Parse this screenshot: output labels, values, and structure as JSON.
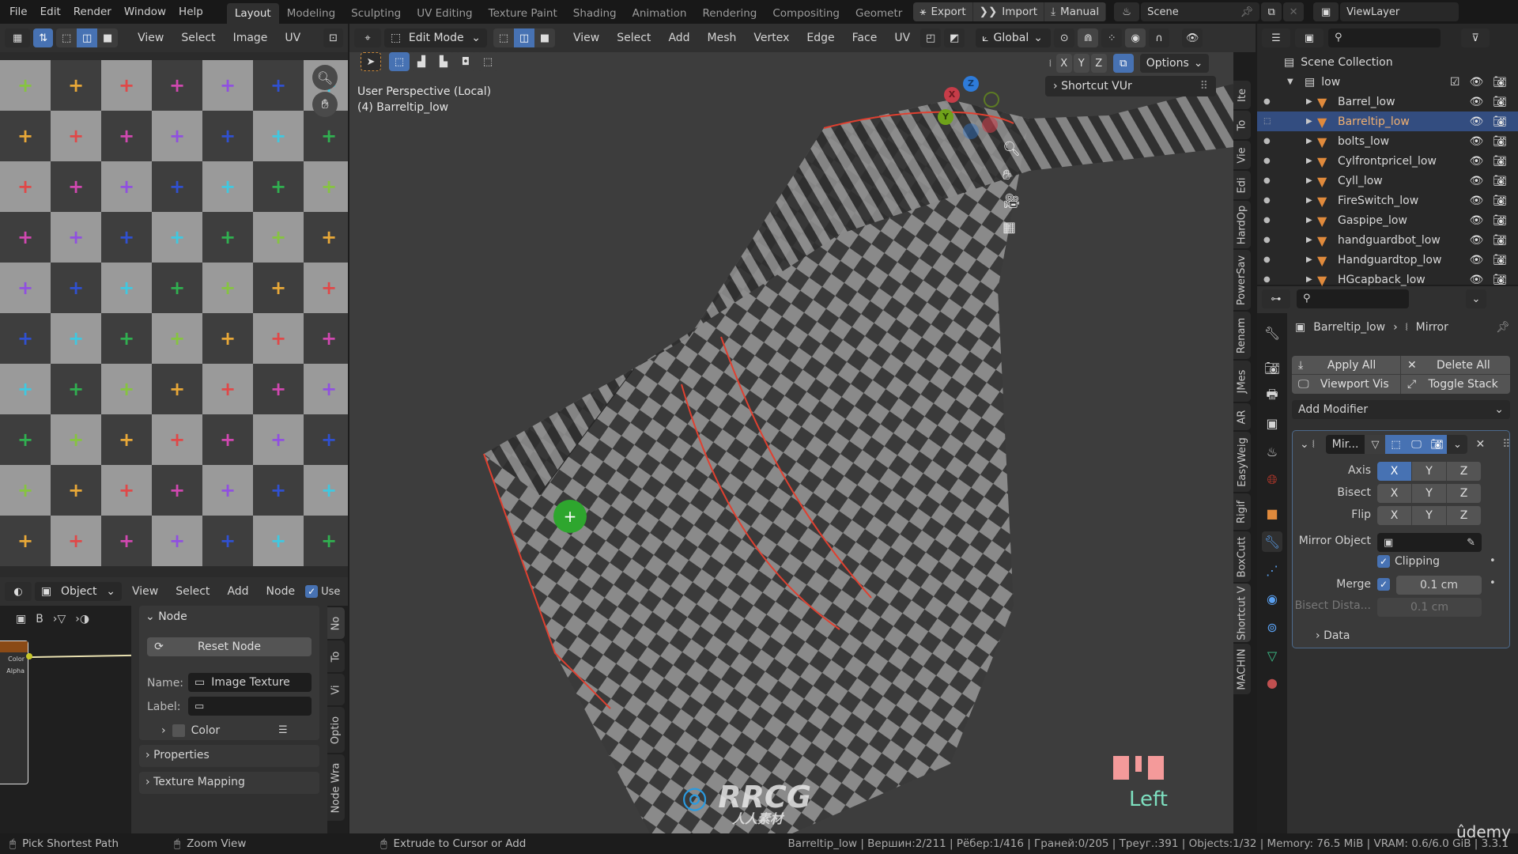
{
  "topbar": {
    "menus": [
      "File",
      "Edit",
      "Render",
      "Window",
      "Help"
    ],
    "workspaces": [
      "Layout",
      "Modeling",
      "Sculpting",
      "UV Editing",
      "Texture Paint",
      "Shading",
      "Animation",
      "Rendering",
      "Compositing",
      "Geometr"
    ],
    "active_workspace": "Layout",
    "export_label": "Export",
    "import_label": "Import",
    "manual_label": "Manual",
    "scene_name": "Scene",
    "view_layer": "ViewLayer"
  },
  "uv_editor": {
    "menus": [
      "View",
      "Select",
      "Image",
      "UV"
    ],
    "colors": [
      "#86c440",
      "#e8a838",
      "#e04848",
      "#d048b0",
      "#9050e0",
      "#3050d0",
      "#40c8e0",
      "#30b050"
    ]
  },
  "viewport": {
    "mode": "Edit Mode",
    "menus": [
      "View",
      "Select",
      "Add",
      "Mesh",
      "Vertex",
      "Edge",
      "Face",
      "UV"
    ],
    "transform_orientation": "Global",
    "mirror_axes": [
      "X",
      "Y",
      "Z"
    ],
    "options_label": "Options",
    "overlay_title": "User Perspective (Local)",
    "overlay_object": "(4) Barreltip_low",
    "shortcut_panel": "Shortcut VUr",
    "gizmo_axes": {
      "x": "X",
      "y": "Y",
      "z": "Z"
    },
    "key_display": "Left",
    "side_tabs": [
      "Ite",
      "To",
      "Vie",
      "Edi",
      "HardOp",
      "PowerSav",
      "Renam",
      "JMes",
      "AR",
      "EasyWeig",
      "Rigif",
      "BoxCutt",
      "Shortcut V",
      "MACHIN"
    ]
  },
  "outliner": {
    "root": "Scene Collection",
    "collection": "low",
    "items": [
      {
        "name": "Barrel_low",
        "selected": false
      },
      {
        "name": "Barreltip_low",
        "selected": true
      },
      {
        "name": "bolts_low",
        "selected": false
      },
      {
        "name": "Cylfrontpricel_low",
        "selected": false
      },
      {
        "name": "Cyll_low",
        "selected": false
      },
      {
        "name": "FireSwitch_low",
        "selected": false
      },
      {
        "name": "Gaspipe_low",
        "selected": false
      },
      {
        "name": "handguardbot_low",
        "selected": false
      },
      {
        "name": "Handguardtop_low",
        "selected": false
      },
      {
        "name": "HGcapback_low",
        "selected": false
      }
    ]
  },
  "properties": {
    "object": "Barreltip_low",
    "modifier": "Mirror",
    "apply_all": "Apply All",
    "delete_all": "Delete All",
    "viewport_vis": "Viewport Vis",
    "toggle_stack": "Toggle Stack",
    "add_modifier": "Add Modifier",
    "modifier_short": "Mir...",
    "axis_label": "Axis",
    "bisect_label": "Bisect",
    "flip_label": "Flip",
    "axes": [
      "X",
      "Y",
      "Z"
    ],
    "axis_active": "X",
    "mirror_object_label": "Mirror Object",
    "clipping_label": "Clipping",
    "clipping_checked": true,
    "merge_label": "Merge",
    "merge_checked": true,
    "merge_value": "0.1 cm",
    "bisect_distance_label": "Bisect Dista...",
    "bisect_distance_value": "0.1 cm",
    "data_label": "Data"
  },
  "node_editor": {
    "mode": "Object",
    "menus": [
      "View",
      "Select",
      "Add",
      "Node"
    ],
    "use_label": "Use",
    "use_checked": true,
    "breadcrumb_b": "B",
    "socket_color": "Color",
    "socket_alpha": "Alpha",
    "panel_node": "Node",
    "reset_node": "Reset Node",
    "name_label": "Name:",
    "name_value": "Image Texture",
    "label_label": "Label:",
    "label_value": "",
    "color_label": "Color",
    "properties_label": "Properties",
    "texture_mapping_label": "Texture Mapping",
    "side_tabs": [
      "No",
      "To",
      "Vi",
      "Optio",
      "Node Wra"
    ]
  },
  "statusbar": {
    "hint1": "Pick Shortest Path",
    "hint2": "Zoom View",
    "hint3": "Extrude to Cursor or Add",
    "stats": "Barreltip_low | Вершин:2/211 | Рёбер:1/416 | Граней:0/205 | Треуг.:391 | Objects:1/32 | Memory: 76.5 MiB | VRAM: 0.6/6.0 GiB | 3.3.1"
  },
  "watermarks": {
    "brand": "RRCG",
    "sub": "人人素材",
    "udemy": "ûdemy"
  }
}
